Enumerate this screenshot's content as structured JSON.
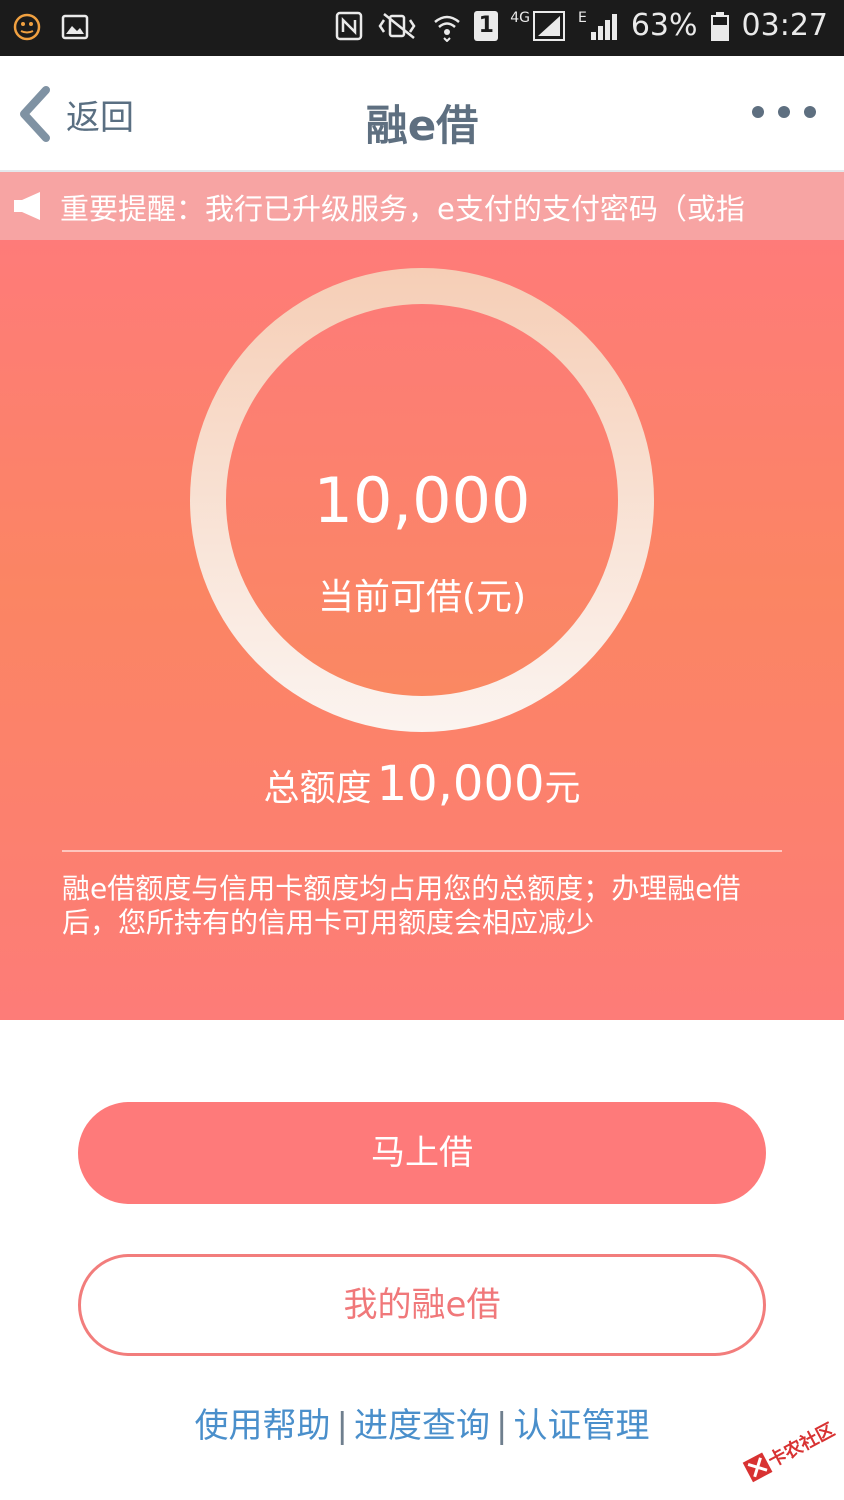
{
  "status_bar": {
    "network": "4G",
    "sim": "1",
    "signal_label": "E",
    "battery": "63%",
    "time": "03:27"
  },
  "header": {
    "back_label": "返回",
    "title": "融e借"
  },
  "notice": {
    "text": "重要提醒：我行已升级服务，e支付的支付密码（或指"
  },
  "loan": {
    "available_amount": "10,000",
    "available_label": "当前可借(元)",
    "total_label": "总额度",
    "total_amount": "10,000",
    "total_unit": "元",
    "note": "融e借额度与信用卡额度均占用您的总额度；办理融e借后，您所持有的信用卡可用额度会相应减少"
  },
  "actions": {
    "borrow_now": "马上借",
    "my_loan": "我的融e借"
  },
  "links": {
    "help": "使用帮助",
    "progress": "进度查询",
    "auth": "认证管理",
    "separator": "|"
  },
  "watermark": "卡农社区",
  "colors": {
    "primary": "#fe7a7a",
    "link": "#4a8fcb",
    "title": "#5e6f80"
  }
}
